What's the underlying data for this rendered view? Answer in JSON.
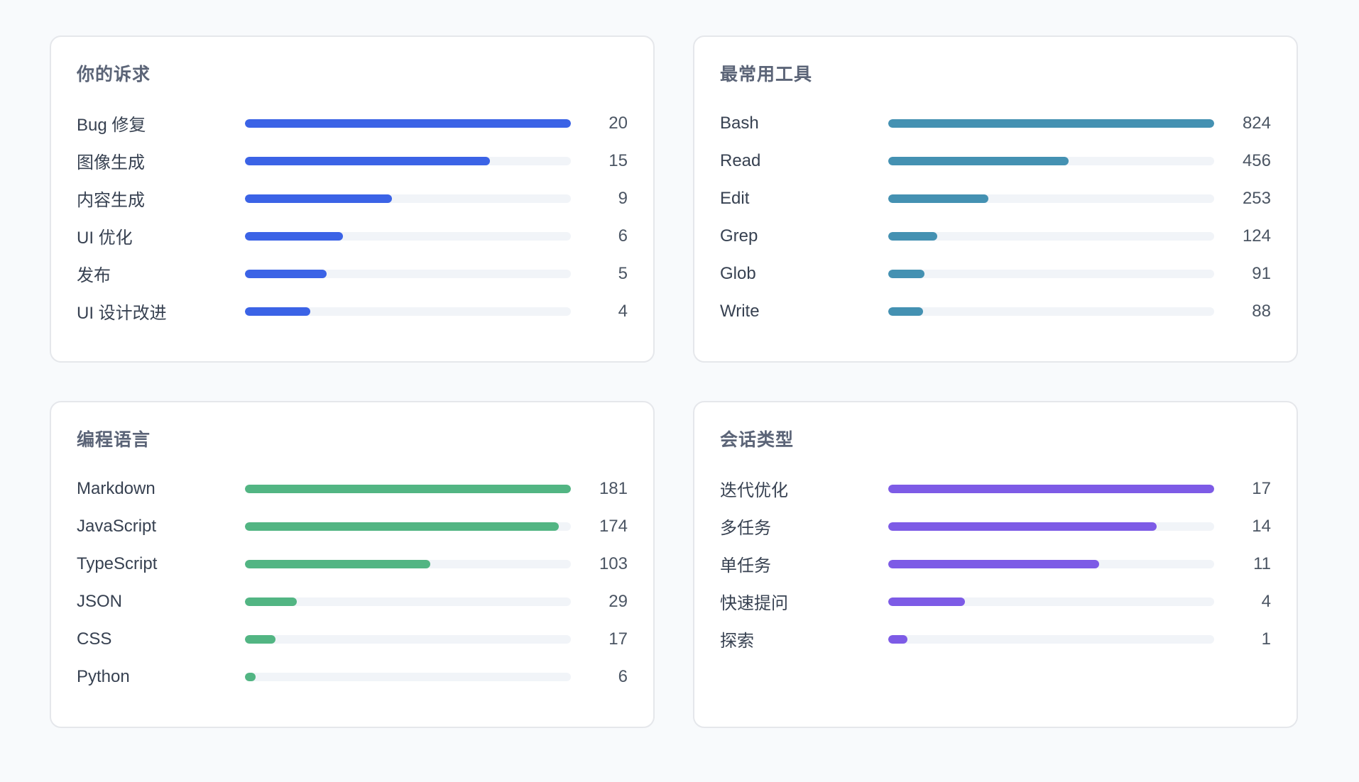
{
  "chart_data": [
    {
      "type": "bar",
      "title": "你的诉求",
      "color": "#3b63e6",
      "categories": [
        "Bug 修复",
        "图像生成",
        "内容生成",
        "UI 优化",
        "发布",
        "UI 设计改进"
      ],
      "values": [
        20,
        15,
        9,
        6,
        5,
        4
      ]
    },
    {
      "type": "bar",
      "title": "最常用工具",
      "color": "#4491b2",
      "categories": [
        "Bash",
        "Read",
        "Edit",
        "Grep",
        "Glob",
        "Write"
      ],
      "values": [
        824,
        456,
        253,
        124,
        91,
        88
      ]
    },
    {
      "type": "bar",
      "title": "编程语言",
      "color": "#52b583",
      "categories": [
        "Markdown",
        "JavaScript",
        "TypeScript",
        "JSON",
        "CSS",
        "Python"
      ],
      "values": [
        181,
        174,
        103,
        29,
        17,
        6
      ]
    },
    {
      "type": "bar",
      "title": "会话类型",
      "color": "#7d5be6",
      "categories": [
        "迭代优化",
        "多任务",
        "单任务",
        "快速提问",
        "探索"
      ],
      "values": [
        17,
        14,
        11,
        4,
        1
      ]
    }
  ]
}
